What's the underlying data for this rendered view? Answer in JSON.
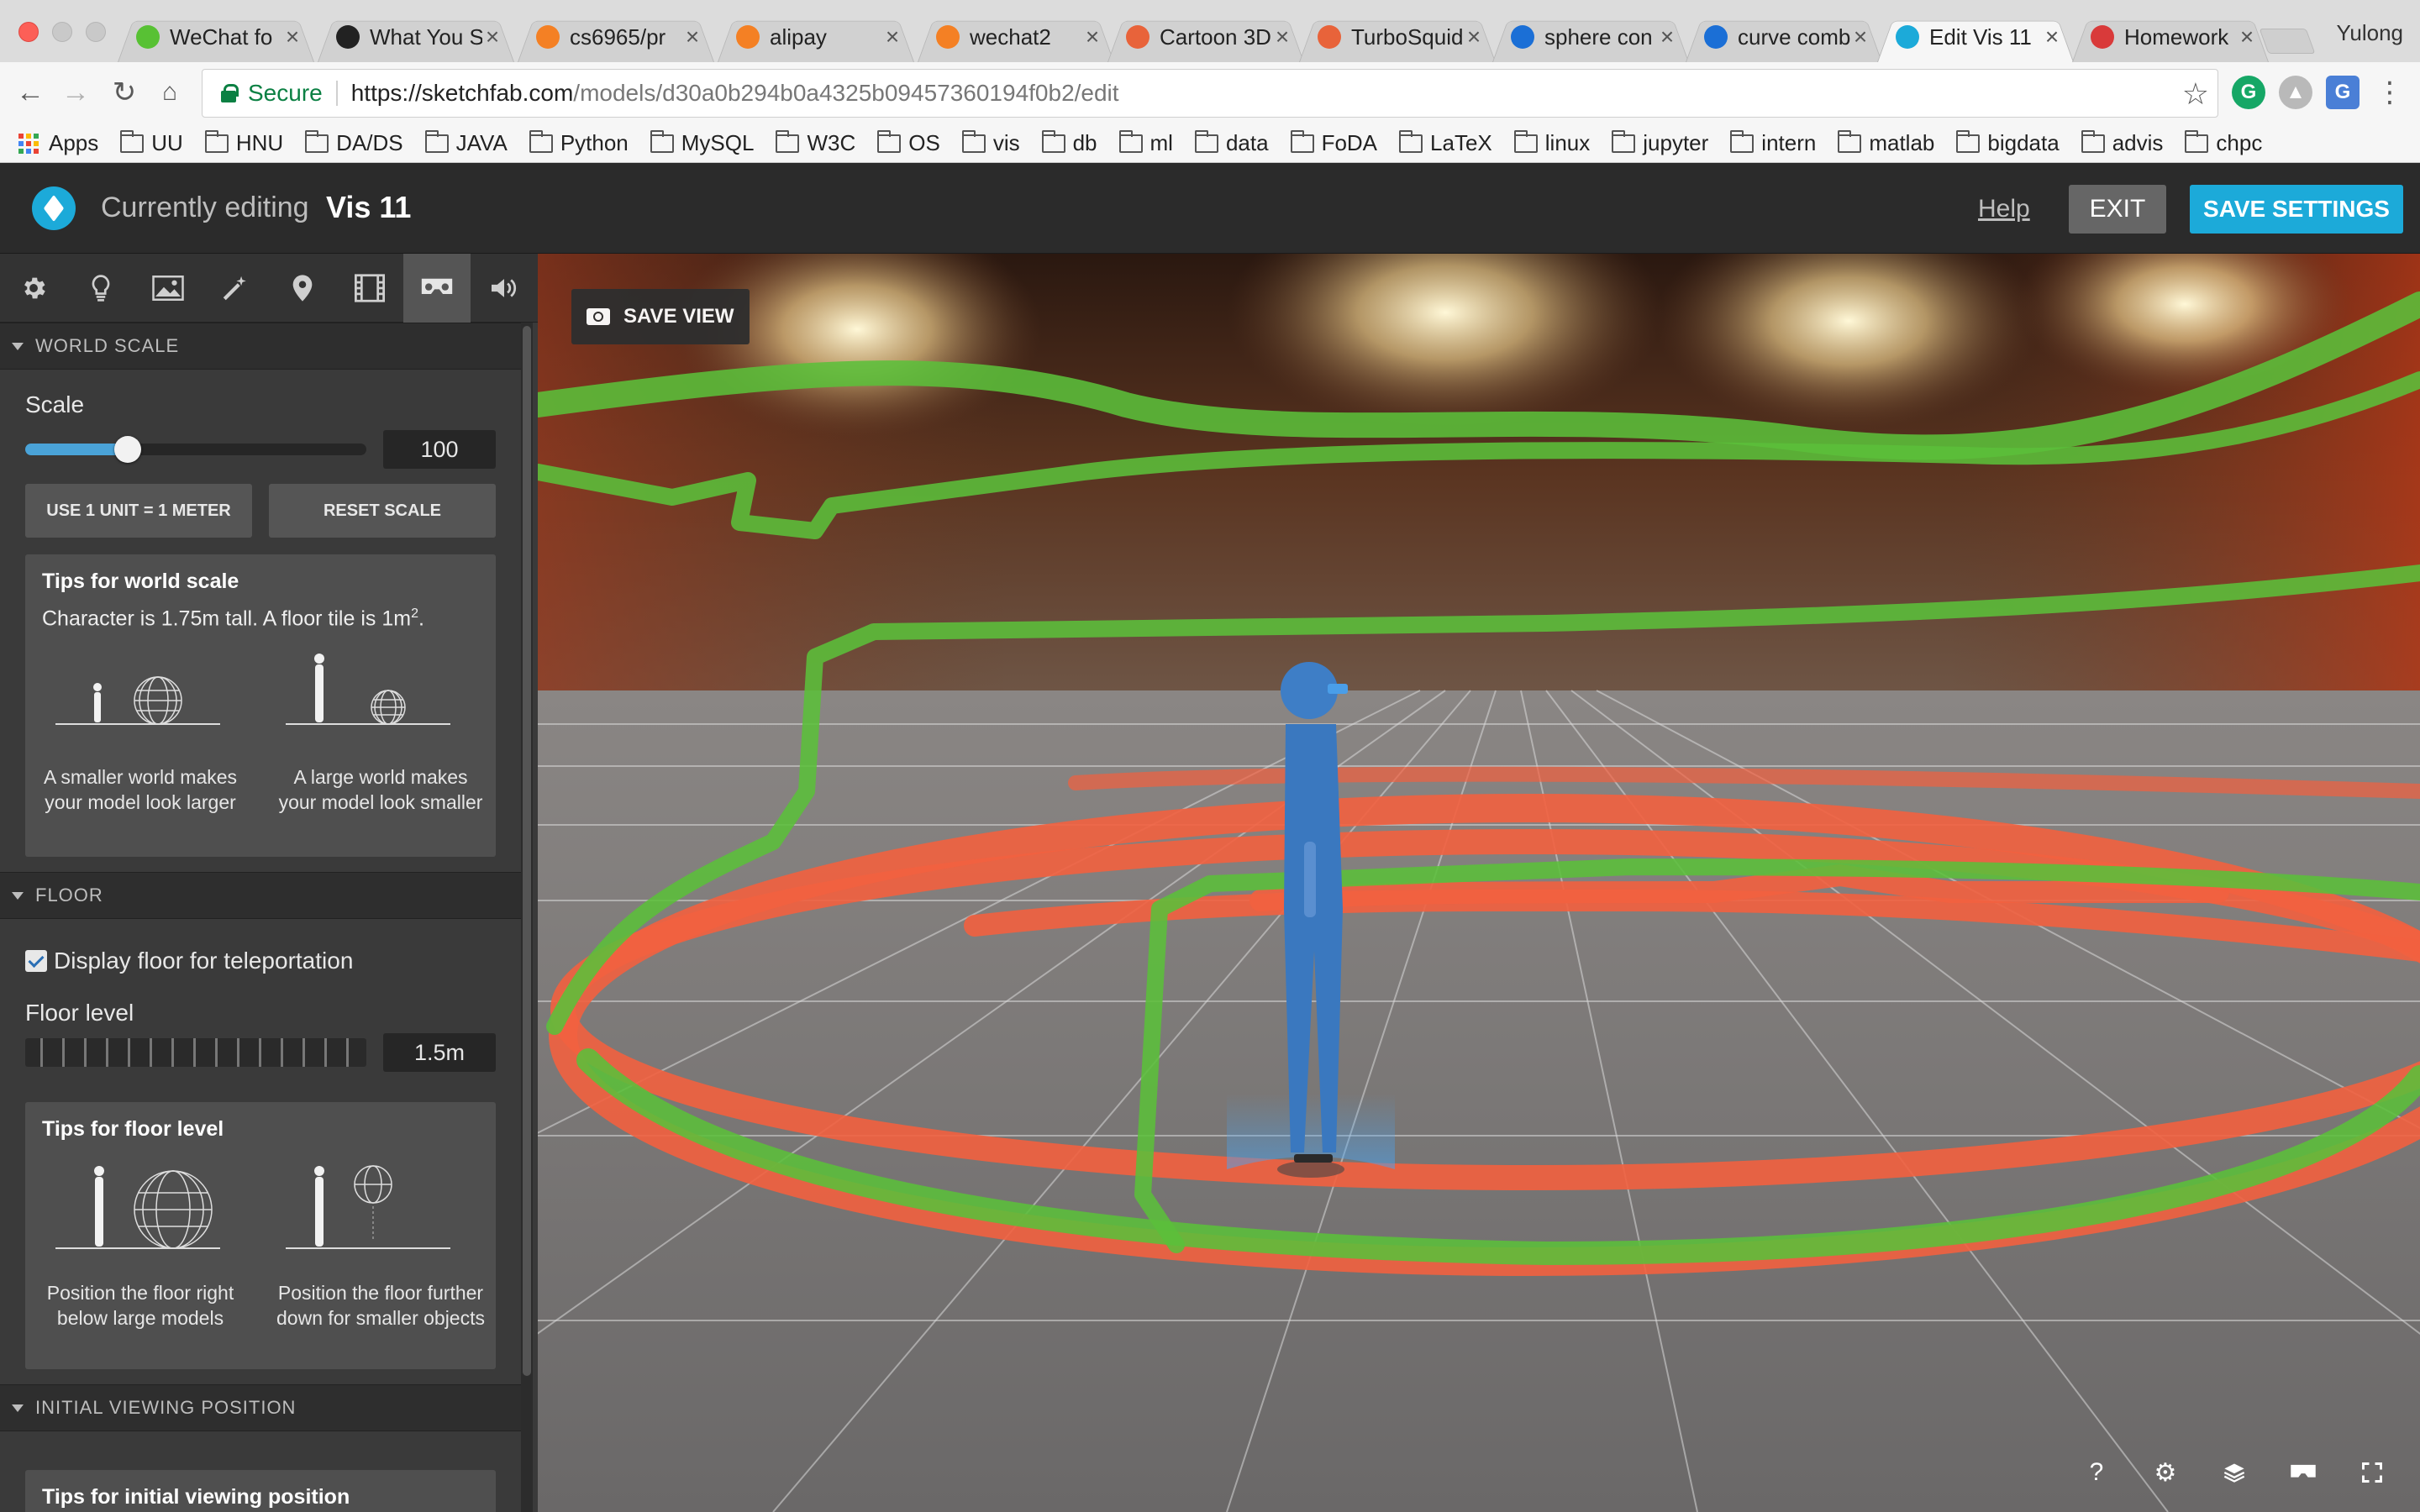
{
  "browser": {
    "tabs": [
      {
        "title": "WeChat fo",
        "icon_color": "#58c134",
        "icon": "wechat-icon",
        "active": false
      },
      {
        "title": "What You S",
        "icon_color": "#222222",
        "icon": "android-icon",
        "active": false
      },
      {
        "title": "cs6965/pr",
        "icon_color": "#f48024",
        "icon": "loading-icon",
        "active": false
      },
      {
        "title": "alipay",
        "icon_color": "#f48024",
        "icon": "loading-icon",
        "active": false
      },
      {
        "title": "wechat2",
        "icon_color": "#f48024",
        "icon": "loading-icon",
        "active": false
      },
      {
        "title": "Cartoon 3D",
        "icon_color": "#e8633a",
        "icon": "turbosquid-icon",
        "active": false
      },
      {
        "title": "TurboSquid",
        "icon_color": "#e8633a",
        "icon": "turbosquid-icon",
        "active": false
      },
      {
        "title": "sphere con",
        "icon_color": "#1b6fd6",
        "icon": "autodesk-icon",
        "active": false
      },
      {
        "title": "curve comb",
        "icon_color": "#1b6fd6",
        "icon": "autodesk-icon",
        "active": false
      },
      {
        "title": "Edit Vis 11",
        "icon_color": "#1caad9",
        "icon": "sketchfab-icon",
        "active": true
      },
      {
        "title": "Homework",
        "icon_color": "#d93a3a",
        "icon": "uu-icon",
        "active": false
      }
    ],
    "profile_name": "Yulong",
    "secure_label": "Secure",
    "url_host": "https://sketchfab.com",
    "url_path": "/models/d30a0b294b0a4325b09457360194f0b2/edit",
    "bookmarks": [
      "Apps",
      "UU",
      "HNU",
      "DA/DS",
      "JAVA",
      "Python",
      "MySQL",
      "W3C",
      "OS",
      "vis",
      "db",
      "ml",
      "data",
      "FoDA",
      "LaTeX",
      "linux",
      "jupyter",
      "intern",
      "matlab",
      "bigdata",
      "advis",
      "chpc"
    ]
  },
  "header": {
    "editing_label": "Currently editing",
    "model_name": "Vis 11",
    "help": "Help",
    "exit": "EXIT",
    "save": "SAVE SETTINGS"
  },
  "sidebar": {
    "tools": [
      "gear-icon",
      "bulb-icon",
      "image-icon",
      "wand-icon",
      "pin-icon",
      "film-icon",
      "vr-icon",
      "sound-icon"
    ],
    "active_tool": 6,
    "world_scale": {
      "heading": "WORLD SCALE",
      "scale_label": "Scale",
      "scale_value": "100",
      "slider_fraction": 0.3,
      "btn_meter": "USE 1 UNIT = 1 METER",
      "btn_reset": "RESET SCALE",
      "tips_title": "Tips for world scale",
      "tips_text": "Character is 1.75m tall. A floor tile is 1m²."
    },
    "floor": {
      "heading": "FLOOR",
      "display_label": "Display floor for teleportation",
      "display_checked": true,
      "level_label": "Floor level",
      "level_value": "1.5m",
      "tips_title": "Tips for floor level"
    },
    "initial": {
      "heading": "INITIAL VIEWING POSITION",
      "tips_title": "Tips for initial viewing position"
    }
  },
  "viewport": {
    "save_view": "SAVE VIEW",
    "tools": [
      "help-icon",
      "settings-icon",
      "layers-icon",
      "vr-icon",
      "fullscreen-icon"
    ]
  },
  "colors": {
    "accent": "#1caad9",
    "slider": "#4aa3d8",
    "curve_red": "#f2603f",
    "curve_green": "#5bbf3a"
  }
}
